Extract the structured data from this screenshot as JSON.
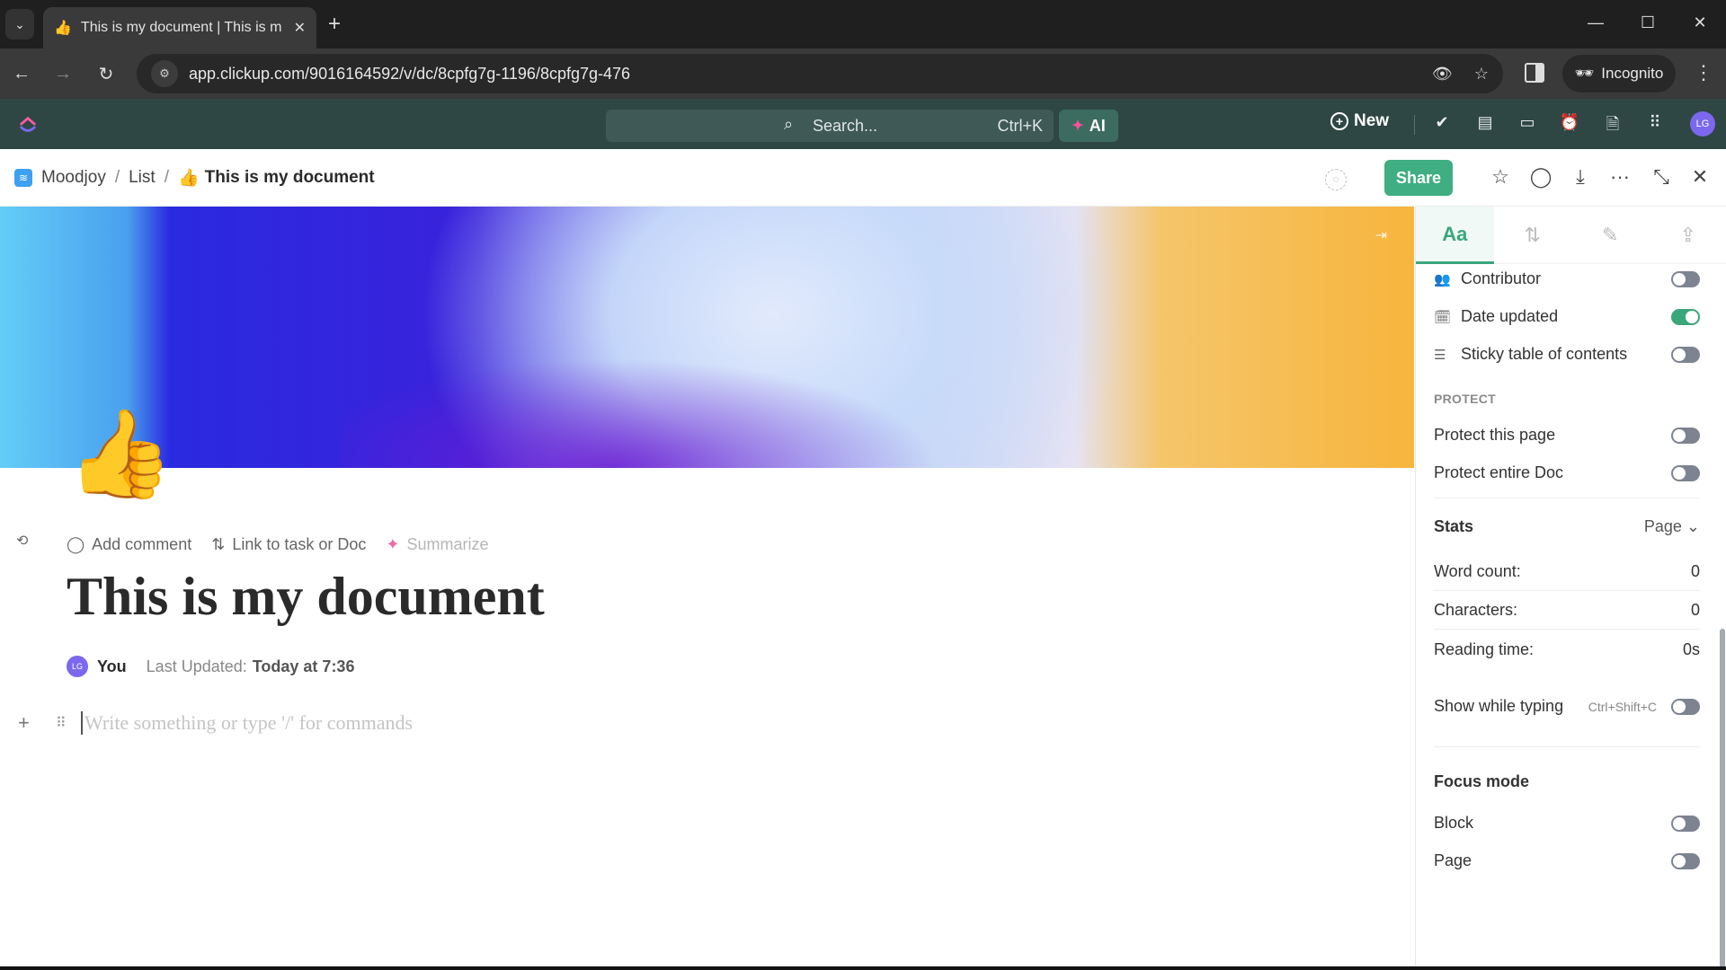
{
  "browser": {
    "tab_title": "This is my document | This is m",
    "tab_favicon": "👍",
    "url": "app.clickup.com/9016164592/v/dc/8cpfg7g-1196/8cpfg7g-476",
    "incognito_label": "Incognito",
    "icons": {
      "tab_list": "⌄",
      "close_tab": "✕",
      "new_tab": "+",
      "minimize": "—",
      "maximize": "☐",
      "close_window": "✕",
      "back": "←",
      "forward": "→",
      "reload": "↻",
      "site_info": "⚙",
      "eye_off": "👁",
      "bookmark": "☆",
      "menu": "⋮",
      "incognito": "🕶"
    }
  },
  "appbar": {
    "search_placeholder": "Search...",
    "search_shortcut": "Ctrl+K",
    "ai_label": "AI",
    "new_label": "New",
    "avatar_initials": "LG",
    "icons": [
      "✔",
      "▤",
      "▭",
      "⏰",
      "🗎",
      "⠿"
    ]
  },
  "docbar": {
    "breadcrumb": [
      {
        "label": "Moodjoy"
      },
      {
        "label": "List"
      },
      {
        "label": "This is my document",
        "emoji": "👍"
      }
    ],
    "separator": "/",
    "share_label": "Share",
    "icons": {
      "tag": "◌",
      "star": "☆",
      "comment": "◯",
      "export": "⤓",
      "more": "···",
      "collapse": "⤡",
      "close": "✕"
    }
  },
  "document": {
    "emoji": "👍",
    "actions": [
      {
        "icon": "◯",
        "label": "Add comment"
      },
      {
        "icon": "⇅",
        "label": "Link to task or Doc"
      },
      {
        "icon": "✦",
        "label": "Summarize"
      }
    ],
    "title": "This is my document",
    "author_initials": "LG",
    "author": "You",
    "last_updated_label": "Last Updated:",
    "last_updated_value": "Today at 7:36",
    "editor_placeholder": "Write something or type '/' for commands"
  },
  "panel": {
    "tabs": [
      {
        "label": "Aa",
        "active": true
      },
      {
        "label": "⇅",
        "active": false
      },
      {
        "label": "✎",
        "active": false
      },
      {
        "label": "⇪",
        "active": false
      }
    ],
    "display_toggles": [
      {
        "icon": "👥",
        "label": "Contributor",
        "on": false
      },
      {
        "icon": "🗓",
        "label": "Date updated",
        "on": true
      },
      {
        "icon": "☰",
        "label": "Sticky table of contents",
        "on": false
      }
    ],
    "protect_heading": "PROTECT",
    "protect_toggles": [
      {
        "label": "Protect this page",
        "on": false
      },
      {
        "label": "Protect entire Doc",
        "on": false
      }
    ],
    "stats": {
      "heading": "Stats",
      "scope": "Page ⌄",
      "rows": [
        {
          "label": "Word count:",
          "value": "0"
        },
        {
          "label": "Characters:",
          "value": "0"
        },
        {
          "label": "Reading time:",
          "value": "0s"
        }
      ],
      "show_while_typing": {
        "label": "Show while typing",
        "shortcut": "Ctrl+Shift+C",
        "on": false
      }
    },
    "focus": {
      "heading": "Focus mode",
      "toggles": [
        {
          "label": "Block",
          "on": false
        },
        {
          "label": "Page",
          "on": false
        }
      ]
    }
  }
}
